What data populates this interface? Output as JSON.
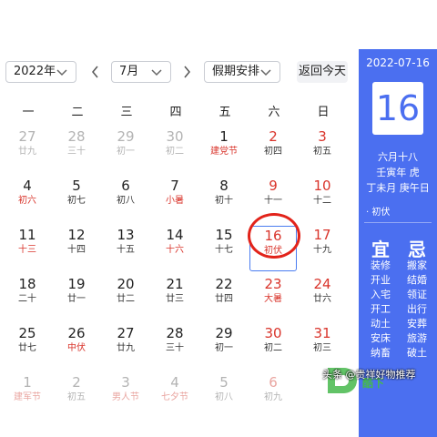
{
  "toolbar": {
    "year": "2022年",
    "month": "7月",
    "holiday": "假期安排",
    "today_btn": "返回今天"
  },
  "weekdays": [
    "一",
    "二",
    "三",
    "四",
    "五",
    "六",
    "日"
  ],
  "weeks": [
    [
      {
        "d": "27",
        "l": "廿九",
        "s": "dim"
      },
      {
        "d": "28",
        "l": "三十",
        "s": "dim"
      },
      {
        "d": "29",
        "l": "初一",
        "s": "dim"
      },
      {
        "d": "30",
        "l": "初二",
        "s": "dim"
      },
      {
        "d": "1",
        "l": "建党节",
        "s": "lred"
      },
      {
        "d": "2",
        "l": "初四",
        "s": "red"
      },
      {
        "d": "3",
        "l": "初五",
        "s": "red"
      }
    ],
    [
      {
        "d": "4",
        "l": "初六",
        "s": "lred"
      },
      {
        "d": "5",
        "l": "初七",
        "s": ""
      },
      {
        "d": "6",
        "l": "初八",
        "s": ""
      },
      {
        "d": "7",
        "l": "小暑",
        "s": "lred"
      },
      {
        "d": "8",
        "l": "初十",
        "s": ""
      },
      {
        "d": "9",
        "l": "十一",
        "s": "red"
      },
      {
        "d": "10",
        "l": "十二",
        "s": "red"
      }
    ],
    [
      {
        "d": "11",
        "l": "十三",
        "s": "lred"
      },
      {
        "d": "12",
        "l": "十四",
        "s": ""
      },
      {
        "d": "13",
        "l": "十五",
        "s": ""
      },
      {
        "d": "14",
        "l": "十六",
        "s": "lred"
      },
      {
        "d": "15",
        "l": "十七",
        "s": ""
      },
      {
        "d": "16",
        "l": "初伏",
        "s": "today"
      },
      {
        "d": "17",
        "l": "十九",
        "s": "red"
      }
    ],
    [
      {
        "d": "18",
        "l": "二十",
        "s": ""
      },
      {
        "d": "19",
        "l": "廿一",
        "s": ""
      },
      {
        "d": "20",
        "l": "廿二",
        "s": ""
      },
      {
        "d": "21",
        "l": "廿三",
        "s": ""
      },
      {
        "d": "22",
        "l": "廿四",
        "s": ""
      },
      {
        "d": "23",
        "l": "大暑",
        "s": "red lred"
      },
      {
        "d": "24",
        "l": "廿六",
        "s": "red"
      }
    ],
    [
      {
        "d": "25",
        "l": "廿七",
        "s": ""
      },
      {
        "d": "26",
        "l": "中伏",
        "s": "lred"
      },
      {
        "d": "27",
        "l": "廿九",
        "s": ""
      },
      {
        "d": "28",
        "l": "三十",
        "s": ""
      },
      {
        "d": "29",
        "l": "初一",
        "s": ""
      },
      {
        "d": "30",
        "l": "初二",
        "s": "red"
      },
      {
        "d": "31",
        "l": "初三",
        "s": "red"
      }
    ],
    [
      {
        "d": "1",
        "l": "建军节",
        "s": "dim dimlred"
      },
      {
        "d": "2",
        "l": "初五",
        "s": "dim"
      },
      {
        "d": "3",
        "l": "男人节",
        "s": "dim dimlred"
      },
      {
        "d": "4",
        "l": "七夕节",
        "s": "dim dimlred"
      },
      {
        "d": "5",
        "l": "初八",
        "s": "dim"
      },
      {
        "d": "6",
        "l": "初九",
        "s": "dim dimred"
      },
      {
        "d": "",
        "l": "",
        "s": "dim"
      }
    ]
  ],
  "side": {
    "date": "2022-07-16",
    "day": "16",
    "lunar": "六月十八",
    "ganzhi_year": "壬寅年 虎",
    "ganzhi_md": "丁未月 庚午日",
    "term": "· 初伏",
    "yi": "宜",
    "ji": "忌",
    "yi_items": [
      "装修",
      "开业",
      "入宅",
      "开工",
      "动土",
      "安床",
      "纳畜"
    ],
    "ji_items": [
      "搬家",
      "结婚",
      "领证",
      "出行",
      "安葬",
      "旅游",
      "破土"
    ]
  },
  "overlay": {
    "caption": "头条 @贵祥好物推荐",
    "watermark": "酷下"
  },
  "colors": {
    "accent": "#4b6ff0",
    "holiday_red": "#d9342b",
    "today_circle": "#e2231a"
  }
}
